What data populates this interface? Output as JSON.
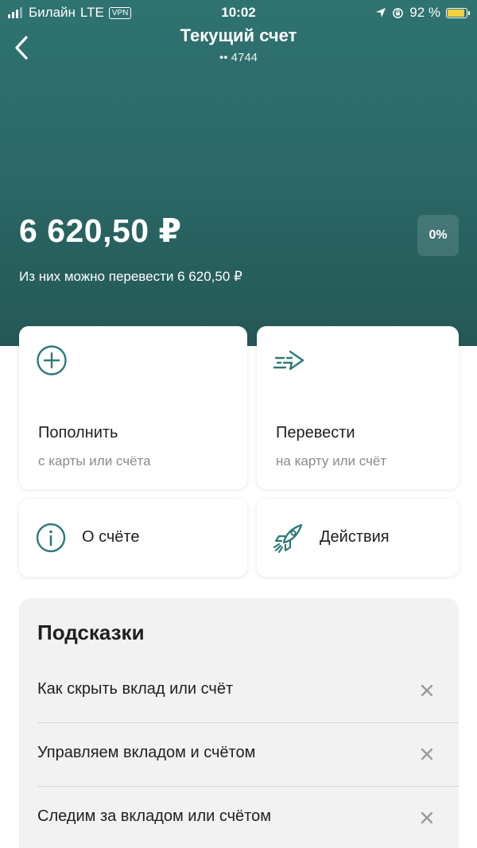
{
  "status_bar": {
    "carrier": "Билайн",
    "network": "LTE",
    "vpn": "VPN",
    "time": "10:02",
    "battery": "92 %",
    "battery_level": 0.92
  },
  "header": {
    "title": "Текущий счет",
    "account_mask": "•• 4744"
  },
  "account": {
    "balance": "6 620,50 ₽",
    "rate": "0%",
    "available": "Из них можно перевести 6 620,50 ₽"
  },
  "actions": {
    "top_up": {
      "title": "Пополнить",
      "subtitle": "с карты или счёта",
      "icon": "plus-circle-icon"
    },
    "transfer": {
      "title": "Перевести",
      "subtitle": "на карту или счёт",
      "icon": "arrow-transfer-icon"
    },
    "about": {
      "label": "О счёте",
      "icon": "info-icon"
    },
    "more": {
      "label": "Действия",
      "icon": "rocket-icon"
    }
  },
  "hints": {
    "title": "Подсказки",
    "items": [
      {
        "label": "Как скрыть вклад или счёт"
      },
      {
        "label": "Управляем вкладом и счётом"
      },
      {
        "label": "Следим за вкладом или счётом"
      }
    ]
  },
  "colors": {
    "accent": "#2d7a77",
    "hero_top": "#2f7371",
    "hero_bottom": "#245856",
    "battery": "#f2d23c"
  }
}
